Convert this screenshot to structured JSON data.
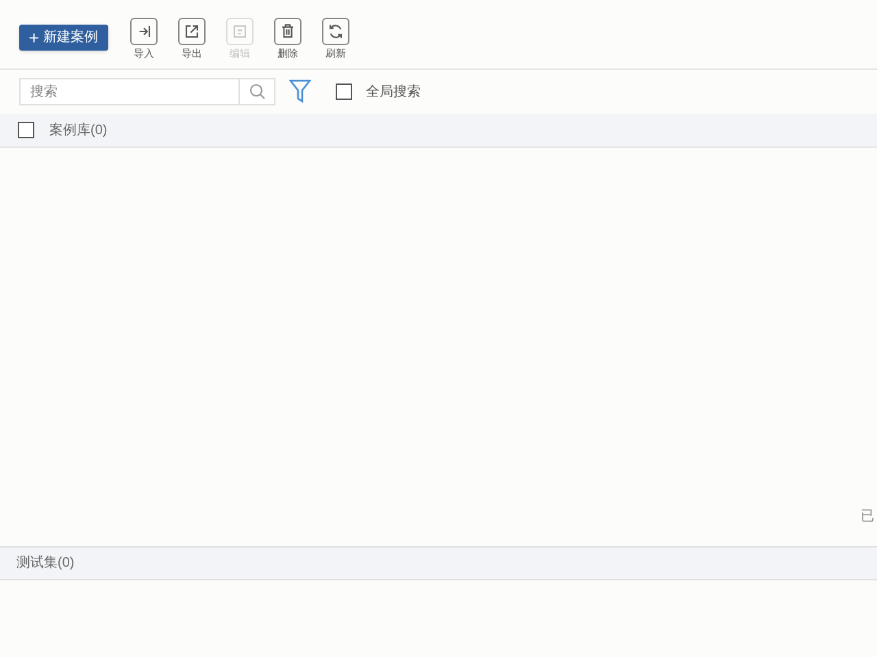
{
  "toolbar": {
    "primary_button": {
      "icon": "+",
      "label": "新建案例"
    },
    "actions": [
      {
        "kind": "import",
        "label": "导入",
        "disabled": false
      },
      {
        "kind": "export",
        "label": "导出",
        "disabled": false
      },
      {
        "kind": "edit",
        "label": "编辑",
        "disabled": true
      },
      {
        "kind": "delete",
        "label": "删除",
        "disabled": false
      },
      {
        "kind": "refresh",
        "label": "刷新",
        "disabled": false
      }
    ]
  },
  "search": {
    "placeholder": "搜索",
    "global_search": {
      "label": "全局搜索",
      "checked": false
    }
  },
  "case_library": {
    "label": "案例库(0)",
    "checked": false,
    "footer_text": "已"
  },
  "test_set": {
    "label": "测试集(0)"
  }
}
